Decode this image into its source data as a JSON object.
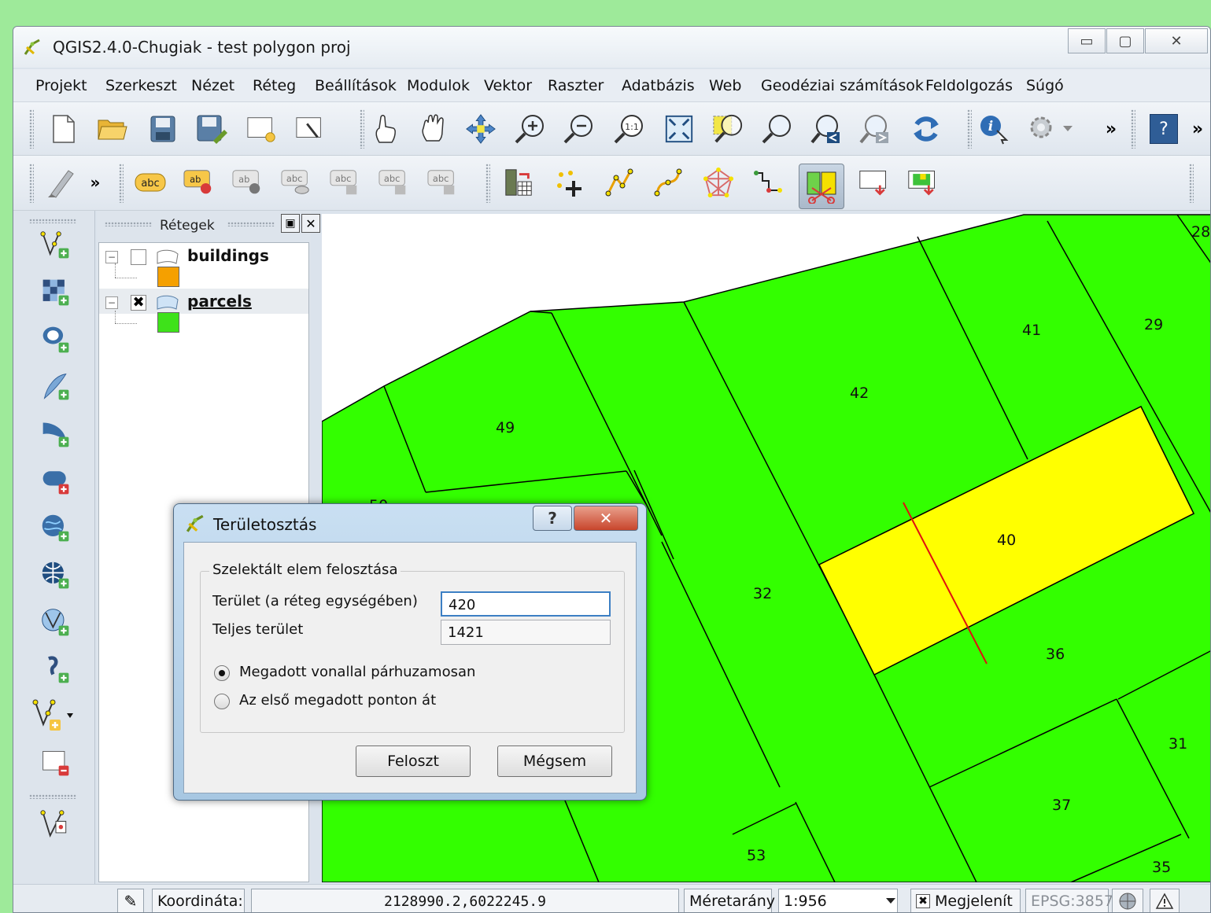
{
  "window": {
    "title": "QGIS2.4.0-Chugiak - test polygon proj",
    "min": "▭",
    "max": "▢",
    "close": "✕"
  },
  "menu": [
    "Projekt",
    "Szerkeszt",
    "Nézet",
    "Réteg",
    "Beállítások",
    "Modulok",
    "Vektor",
    "Raszter",
    "Adatbázis",
    "Web",
    "Geodéziai számítások",
    "Feldolgozás",
    "Súgó"
  ],
  "toolbar": {
    "overflow": "»",
    "help": "?"
  },
  "layers": {
    "title": "Rétegek",
    "items": [
      {
        "name": "buildings",
        "checked": false,
        "color": "#f5a000"
      },
      {
        "name": "parcels",
        "checked": true,
        "color": "#3ee21a"
      }
    ]
  },
  "map": {
    "fill": "#33ff00",
    "selected_fill": "#ffff00",
    "parcel_labels": [
      "28",
      "29",
      "41",
      "42",
      "49",
      "50",
      "40",
      "32",
      "36",
      "31",
      "37",
      "53",
      "35"
    ]
  },
  "dialog": {
    "title": "Területosztás",
    "help": "?",
    "close": "✕",
    "group": "Szelektált elem felosztása",
    "area_label": "Terület (a réteg egységében)",
    "area_value": "420",
    "total_label": "Teljes terület",
    "total_value": "1421",
    "option1": "Megadott vonallal párhuzamosan",
    "option2": "Az első megadott ponton át",
    "split_btn": "Feloszt",
    "cancel_btn": "Mégsem"
  },
  "status": {
    "coord_label": "Koordináta:",
    "coord_value": "2128990.2,6022245.9",
    "scale_label": "Méretarány",
    "scale_value": "1:956",
    "render_label": "Megjelenít",
    "crs": "EPSG:3857"
  }
}
